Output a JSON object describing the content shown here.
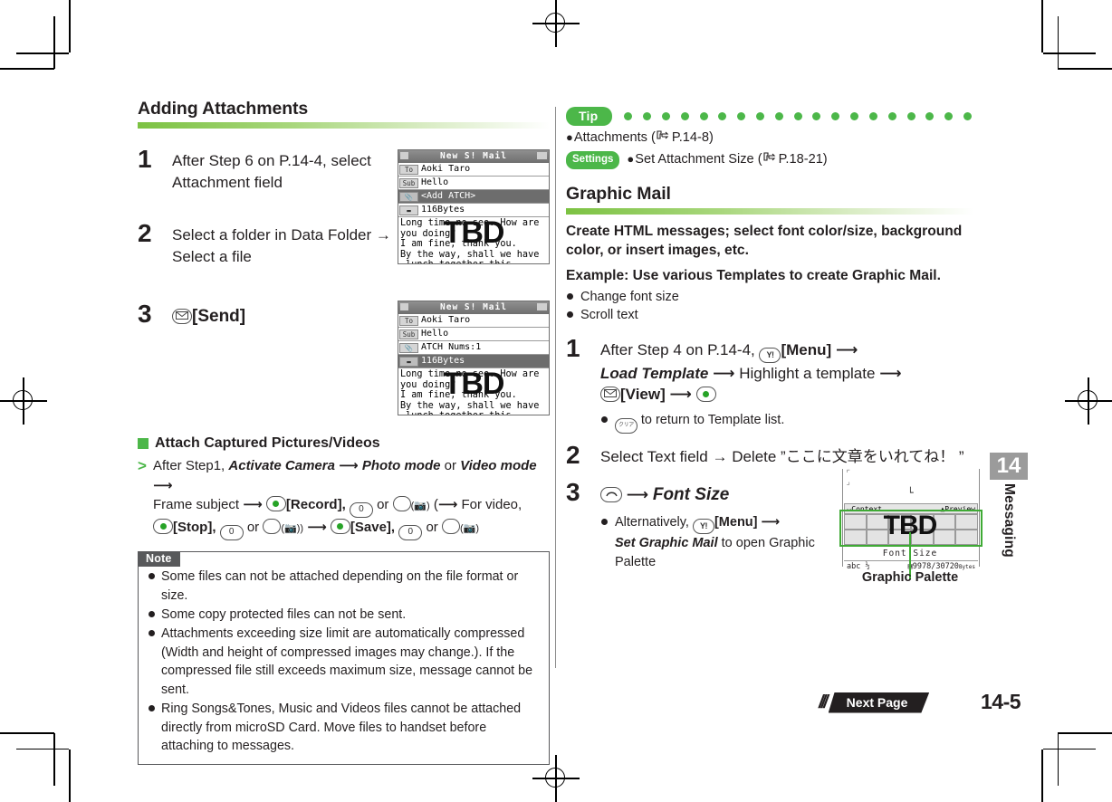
{
  "page": {
    "number": "14-5",
    "chapter_number": "14",
    "chapter_label": "Messaging",
    "next_page_label": "Next Page"
  },
  "left_column": {
    "heading": "Adding Attachments",
    "steps": [
      {
        "num": "1",
        "text": "After Step 6 on P.14-4, select Attachment field"
      },
      {
        "num": "2",
        "text": "Select a folder in Data Folder → Select a file"
      },
      {
        "num": "3",
        "key_icon": "envelope-key-icon",
        "text": "[Send]"
      }
    ],
    "subsection": {
      "heading": "Attach Captured Pictures/Videos",
      "line1_prefix": "After Step1,",
      "line1_italic_a": "Activate Camera",
      "line1_mid": "Photo mode",
      "line1_or": "or",
      "line1_italic_b": "Video mode",
      "line2_a": "Frame subject",
      "line2_record": "[Record],",
      "line2_zero": "0",
      "line2_or": "or",
      "line2_forvideo": "For video,",
      "line3_stop": "[Stop],",
      "line3_save": "[Save],"
    },
    "note": {
      "tag": "Note",
      "items": [
        "Some files can not be attached depending on the file format or size.",
        "Some copy protected files can not be sent.",
        "Attachments exceeding size limit are automatically compressed (Width and height of compressed images may change.). If the compressed file still exceeds maximum size, message cannot be sent.",
        "Ring Songs&Tones, Music and Videos files cannot be attached directly from microSD Card. Move files to handset before attaching to messages."
      ]
    },
    "screenshot_1": {
      "title": "New S! Mail",
      "rows": [
        {
          "tag": "To",
          "value": "Aoki Taro",
          "selected": false
        },
        {
          "tag": "Sub",
          "value": "Hello",
          "selected": false
        },
        {
          "tag": "clip",
          "value": "<Add ATCH>",
          "selected": true
        },
        {
          "tag": "size",
          "value": "116Bytes",
          "selected": false
        }
      ],
      "body": "Long time no see. How are you doing?\nI am fine, thank you.\nBy the way, shall we have\n lunch together this\nSaturday?",
      "overlay": "TBD"
    },
    "screenshot_2": {
      "title": "New S! Mail",
      "rows": [
        {
          "tag": "To",
          "value": "Aoki Taro",
          "selected": false
        },
        {
          "tag": "Sub",
          "value": "Hello",
          "selected": false
        },
        {
          "tag": "clip",
          "value": "ATCH Nums:1",
          "selected": false
        },
        {
          "tag": "size",
          "value": "116Bytes",
          "selected": true
        }
      ],
      "body": "Long time no see. How are you doing?\nI am fine, thank you.\nBy the way, shall we have\n lunch together this\nSaturday?",
      "overlay": "TBD"
    }
  },
  "right_column": {
    "tip": {
      "badge": "Tip",
      "line1": "Attachments (",
      "line1_ref": "P.14-8)",
      "settings_badge": "Settings",
      "line2": "Set Attachment Size (",
      "line2_ref": "P.18-21)"
    },
    "heading": "Graphic Mail",
    "lead1": "Create HTML messages; select font color/size, background color, or insert images, etc.",
    "lead2": "Example: Use various Templates to create Graphic Mail.",
    "bullets": [
      "Change font size",
      "Scroll text"
    ],
    "steps": [
      {
        "num": "1",
        "t1": "After Step 4 on P.14-4,",
        "menu": "[Menu]",
        "t2": "Load Template",
        "t3": "Highlight a template",
        "view": "[View]",
        "sub": "to return to Template list."
      },
      {
        "num": "2",
        "t1": "Select Text field → Delete ”ここに文章をいれてね！ ”"
      },
      {
        "num": "3",
        "t1": "Font Size",
        "sub_pre": "Alternatively,",
        "sub_menu": "[Menu]",
        "sub_ital": "Set Graphic Mail",
        "sub_post": "to open Graphic Palette"
      }
    ],
    "palette": {
      "caption": "Graphic Palette",
      "soft_left": "Context",
      "soft_right": "Preview",
      "label": "Font Size",
      "status_left": "abc ½",
      "status_right": "9978/30720",
      "status_unit": "Bytes",
      "overlay": "TBD"
    }
  },
  "colors": {
    "green": "#4cb749",
    "green_dark": "#3faa35",
    "gray_dark": "#58595b",
    "text": "#231f20"
  }
}
